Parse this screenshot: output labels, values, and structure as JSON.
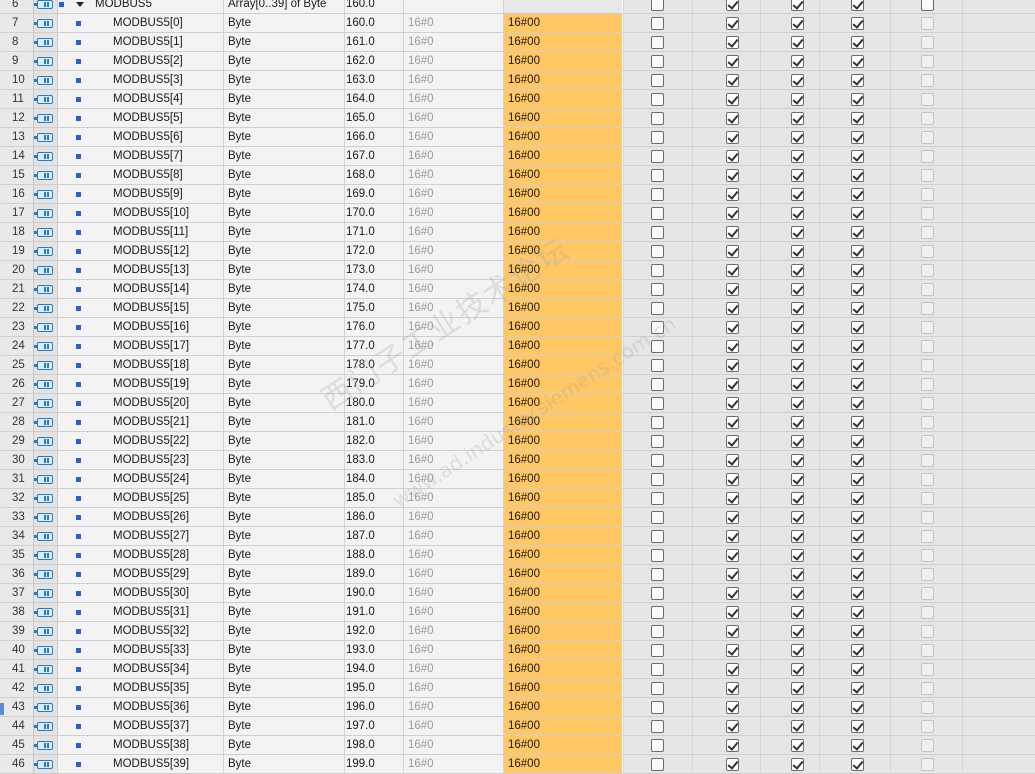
{
  "table": {
    "parent": {
      "num": "6",
      "name": "MODBUS5",
      "type": "Array[0..39] of Byte",
      "offset": "160.0",
      "default": "",
      "monitor": "",
      "checks": [
        false,
        true,
        true,
        true,
        false
      ]
    },
    "rows": [
      {
        "num": "7",
        "name": "MODBUS5[0]",
        "type": "Byte",
        "offset": "160.0",
        "default": "16#0",
        "monitor": "16#00"
      },
      {
        "num": "8",
        "name": "MODBUS5[1]",
        "type": "Byte",
        "offset": "161.0",
        "default": "16#0",
        "monitor": "16#00"
      },
      {
        "num": "9",
        "name": "MODBUS5[2]",
        "type": "Byte",
        "offset": "162.0",
        "default": "16#0",
        "monitor": "16#00"
      },
      {
        "num": "10",
        "name": "MODBUS5[3]",
        "type": "Byte",
        "offset": "163.0",
        "default": "16#0",
        "monitor": "16#00"
      },
      {
        "num": "11",
        "name": "MODBUS5[4]",
        "type": "Byte",
        "offset": "164.0",
        "default": "16#0",
        "monitor": "16#00"
      },
      {
        "num": "12",
        "name": "MODBUS5[5]",
        "type": "Byte",
        "offset": "165.0",
        "default": "16#0",
        "monitor": "16#00"
      },
      {
        "num": "13",
        "name": "MODBUS5[6]",
        "type": "Byte",
        "offset": "166.0",
        "default": "16#0",
        "monitor": "16#00"
      },
      {
        "num": "14",
        "name": "MODBUS5[7]",
        "type": "Byte",
        "offset": "167.0",
        "default": "16#0",
        "monitor": "16#00"
      },
      {
        "num": "15",
        "name": "MODBUS5[8]",
        "type": "Byte",
        "offset": "168.0",
        "default": "16#0",
        "monitor": "16#00"
      },
      {
        "num": "16",
        "name": "MODBUS5[9]",
        "type": "Byte",
        "offset": "169.0",
        "default": "16#0",
        "monitor": "16#00"
      },
      {
        "num": "17",
        "name": "MODBUS5[10]",
        "type": "Byte",
        "offset": "170.0",
        "default": "16#0",
        "monitor": "16#00"
      },
      {
        "num": "18",
        "name": "MODBUS5[11]",
        "type": "Byte",
        "offset": "171.0",
        "default": "16#0",
        "monitor": "16#00"
      },
      {
        "num": "19",
        "name": "MODBUS5[12]",
        "type": "Byte",
        "offset": "172.0",
        "default": "16#0",
        "monitor": "16#00"
      },
      {
        "num": "20",
        "name": "MODBUS5[13]",
        "type": "Byte",
        "offset": "173.0",
        "default": "16#0",
        "monitor": "16#00"
      },
      {
        "num": "21",
        "name": "MODBUS5[14]",
        "type": "Byte",
        "offset": "174.0",
        "default": "16#0",
        "monitor": "16#00"
      },
      {
        "num": "22",
        "name": "MODBUS5[15]",
        "type": "Byte",
        "offset": "175.0",
        "default": "16#0",
        "monitor": "16#00"
      },
      {
        "num": "23",
        "name": "MODBUS5[16]",
        "type": "Byte",
        "offset": "176.0",
        "default": "16#0",
        "monitor": "16#00"
      },
      {
        "num": "24",
        "name": "MODBUS5[17]",
        "type": "Byte",
        "offset": "177.0",
        "default": "16#0",
        "monitor": "16#00"
      },
      {
        "num": "25",
        "name": "MODBUS5[18]",
        "type": "Byte",
        "offset": "178.0",
        "default": "16#0",
        "monitor": "16#00"
      },
      {
        "num": "26",
        "name": "MODBUS5[19]",
        "type": "Byte",
        "offset": "179.0",
        "default": "16#0",
        "monitor": "16#00"
      },
      {
        "num": "27",
        "name": "MODBUS5[20]",
        "type": "Byte",
        "offset": "180.0",
        "default": "16#0",
        "monitor": "16#00"
      },
      {
        "num": "28",
        "name": "MODBUS5[21]",
        "type": "Byte",
        "offset": "181.0",
        "default": "16#0",
        "monitor": "16#00"
      },
      {
        "num": "29",
        "name": "MODBUS5[22]",
        "type": "Byte",
        "offset": "182.0",
        "default": "16#0",
        "monitor": "16#00"
      },
      {
        "num": "30",
        "name": "MODBUS5[23]",
        "type": "Byte",
        "offset": "183.0",
        "default": "16#0",
        "monitor": "16#00"
      },
      {
        "num": "31",
        "name": "MODBUS5[24]",
        "type": "Byte",
        "offset": "184.0",
        "default": "16#0",
        "monitor": "16#00"
      },
      {
        "num": "32",
        "name": "MODBUS5[25]",
        "type": "Byte",
        "offset": "185.0",
        "default": "16#0",
        "monitor": "16#00"
      },
      {
        "num": "33",
        "name": "MODBUS5[26]",
        "type": "Byte",
        "offset": "186.0",
        "default": "16#0",
        "monitor": "16#00"
      },
      {
        "num": "34",
        "name": "MODBUS5[27]",
        "type": "Byte",
        "offset": "187.0",
        "default": "16#0",
        "monitor": "16#00"
      },
      {
        "num": "35",
        "name": "MODBUS5[28]",
        "type": "Byte",
        "offset": "188.0",
        "default": "16#0",
        "monitor": "16#00"
      },
      {
        "num": "36",
        "name": "MODBUS5[29]",
        "type": "Byte",
        "offset": "189.0",
        "default": "16#0",
        "monitor": "16#00"
      },
      {
        "num": "37",
        "name": "MODBUS5[30]",
        "type": "Byte",
        "offset": "190.0",
        "default": "16#0",
        "monitor": "16#00"
      },
      {
        "num": "38",
        "name": "MODBUS5[31]",
        "type": "Byte",
        "offset": "191.0",
        "default": "16#0",
        "monitor": "16#00"
      },
      {
        "num": "39",
        "name": "MODBUS5[32]",
        "type": "Byte",
        "offset": "192.0",
        "default": "16#0",
        "monitor": "16#00"
      },
      {
        "num": "40",
        "name": "MODBUS5[33]",
        "type": "Byte",
        "offset": "193.0",
        "default": "16#0",
        "monitor": "16#00"
      },
      {
        "num": "41",
        "name": "MODBUS5[34]",
        "type": "Byte",
        "offset": "194.0",
        "default": "16#0",
        "monitor": "16#00"
      },
      {
        "num": "42",
        "name": "MODBUS5[35]",
        "type": "Byte",
        "offset": "195.0",
        "default": "16#0",
        "monitor": "16#00"
      },
      {
        "num": "43",
        "name": "MODBUS5[36]",
        "type": "Byte",
        "offset": "196.0",
        "default": "16#0",
        "monitor": "16#00"
      },
      {
        "num": "44",
        "name": "MODBUS5[37]",
        "type": "Byte",
        "offset": "197.0",
        "default": "16#0",
        "monitor": "16#00"
      },
      {
        "num": "45",
        "name": "MODBUS5[38]",
        "type": "Byte",
        "offset": "198.0",
        "default": "16#0",
        "monitor": "16#00"
      },
      {
        "num": "46",
        "name": "MODBUS5[39]",
        "type": "Byte",
        "offset": "199.0",
        "default": "16#0",
        "monitor": "16#00"
      }
    ],
    "child_checks": [
      false,
      true,
      true,
      true,
      false
    ],
    "child_disabled": [
      false,
      false,
      false,
      false,
      true
    ]
  },
  "watermark": {
    "line1": "西门子工业技术论坛",
    "line2": "www.ad.industry.siemens.com.cn"
  },
  "colors": {
    "monitor_bg": "#ffc864",
    "icon_blue": "#2a7bbf",
    "bullet_blue": "#2a63c7"
  },
  "icons": {
    "row_icon": "db-member-icon",
    "expander": "collapse-triangle-icon"
  }
}
